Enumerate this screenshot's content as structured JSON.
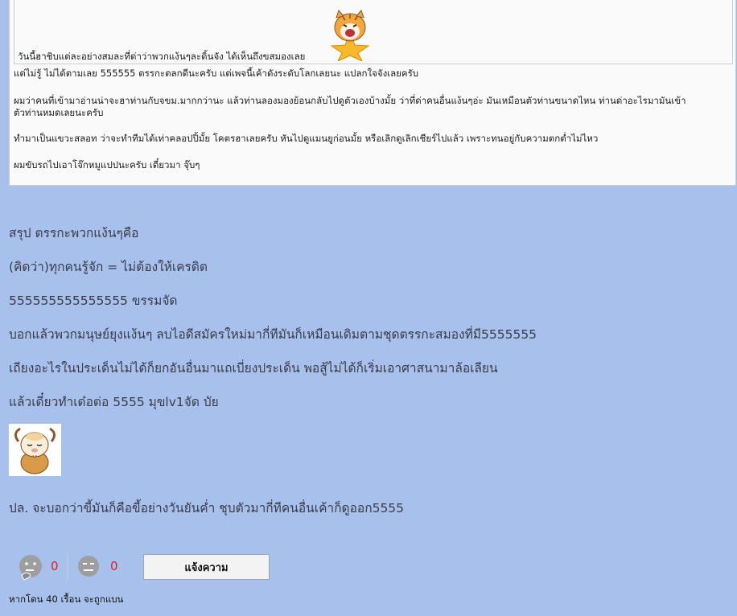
{
  "quote": {
    "inner_line": "วันนี้ฮาชิบแต่ละอย่างสมละที่ด่าว่าพวกแง้นๆละดิ้นจัง ได้เห็นถึงขสมองเลย",
    "paragraphs": [
      "แต่ไม่รู้ ไม่ได้ตามเลย 555555 ตรรกะตลกดีนะครับ แต่เพจนี้เค้าดังระดับโลกเลยนะ แปลกใจจังเลยครับ",
      "ผมว่าคนที่เข้ามาอ่านน่าจะฮาท่านกับจขม.มากกว่านะ แล้วท่านลองมองย้อนกลับไปดูตัวเองบ้างมั้ย ว่าที่ด่าคนอื่นแง้นๆอ่ะ มันเหมือนตัวท่านขนาดไหน ท่านด่าอะไรมามันเข้า",
      "ตัวท่านหมดเลยนะครับ",
      "ทำมาเป็นแขวะสลอท ว่าจะทำทีมได้เท่าคลอปปิ้มั้ย โคตรฮาเลยครับ หันไปดูแมนยูก่อนมั้ย หรือเลิกดูเลิกเชียร์ไปแล้ว เพราะทนอยู่กับความตกต่ำไม่ไหว",
      "ผมขับรถไปเอาโจ๊กหมูแปปนะครับ เดี๋ยวมา จุ๊บๆ"
    ]
  },
  "post": {
    "lines": [
      "สรุป ตรรกะพวกแง้นๆคือ",
      "(คิดว่า)ทุกคนรู้จัก = ไม่ต้องให้เครดิต",
      "555555555555555 ขรรมจัด",
      "บอกแล้วพวกมนุษย์ยุงแง้นๆ ลบไอดีสมัครใหม่มากี่ทีมันก็เหมือนเดิมตามชุดตรรกะสมองที่มี5555555",
      "เถียงอะไรในประเด็นไม่ได้ก็ยกอันอื่นมาแถเบี่ยงประเด็น พอสู้ไม่ได้ก็เริ่มเอาศาสนามาล้อเลียน",
      "แล้วเดี๋ยวทำเด๋อต่อ 5555 มุขlv1จัด บัย"
    ],
    "ps": "ปล. จะบอกว่าขี้มันก็คือขี้อย่างวันยันค่ำ ชุบตัวมากี่ทีคนอื่นเค้าก็ดูออก5555"
  },
  "reactions": {
    "like_icon": "thinking-face-icon",
    "like_count": "0",
    "dislike_icon": "neutral-face-icon",
    "dislike_count": "0"
  },
  "report_button_label": "แจ้งความ",
  "footer_note": "หากโดน 40 เรื้อน จะถูกแบน",
  "colors": {
    "page_bg": "#a7c0ec",
    "quote_bg": "#fafafb",
    "count_red": "#e02020",
    "text_main": "#3a3a48"
  }
}
